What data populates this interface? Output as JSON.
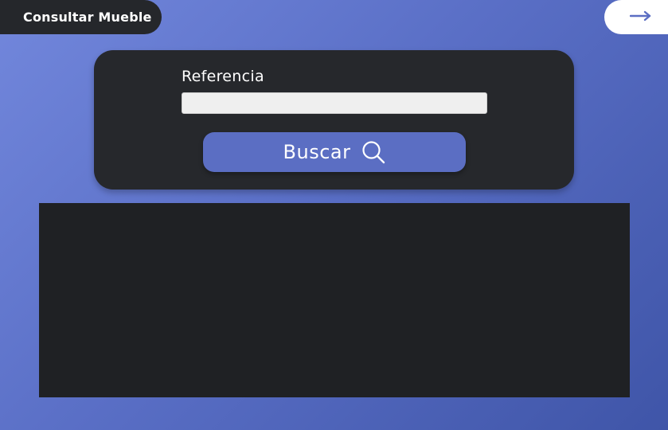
{
  "header": {
    "title": "Consultar Mueble",
    "nav_icon": "arrow-right-icon"
  },
  "search": {
    "label": "Referencia",
    "input_value": "",
    "input_placeholder": "",
    "button_label": "Buscar",
    "button_icon": "magnifier-icon"
  },
  "results": {
    "items": []
  },
  "colors": {
    "background_start": "#7287dc",
    "background_end": "#3f55a8",
    "card": "#26282c",
    "button": "#5b6ec3",
    "results_panel": "#1f2124",
    "arrow": "#5b6ec3"
  }
}
